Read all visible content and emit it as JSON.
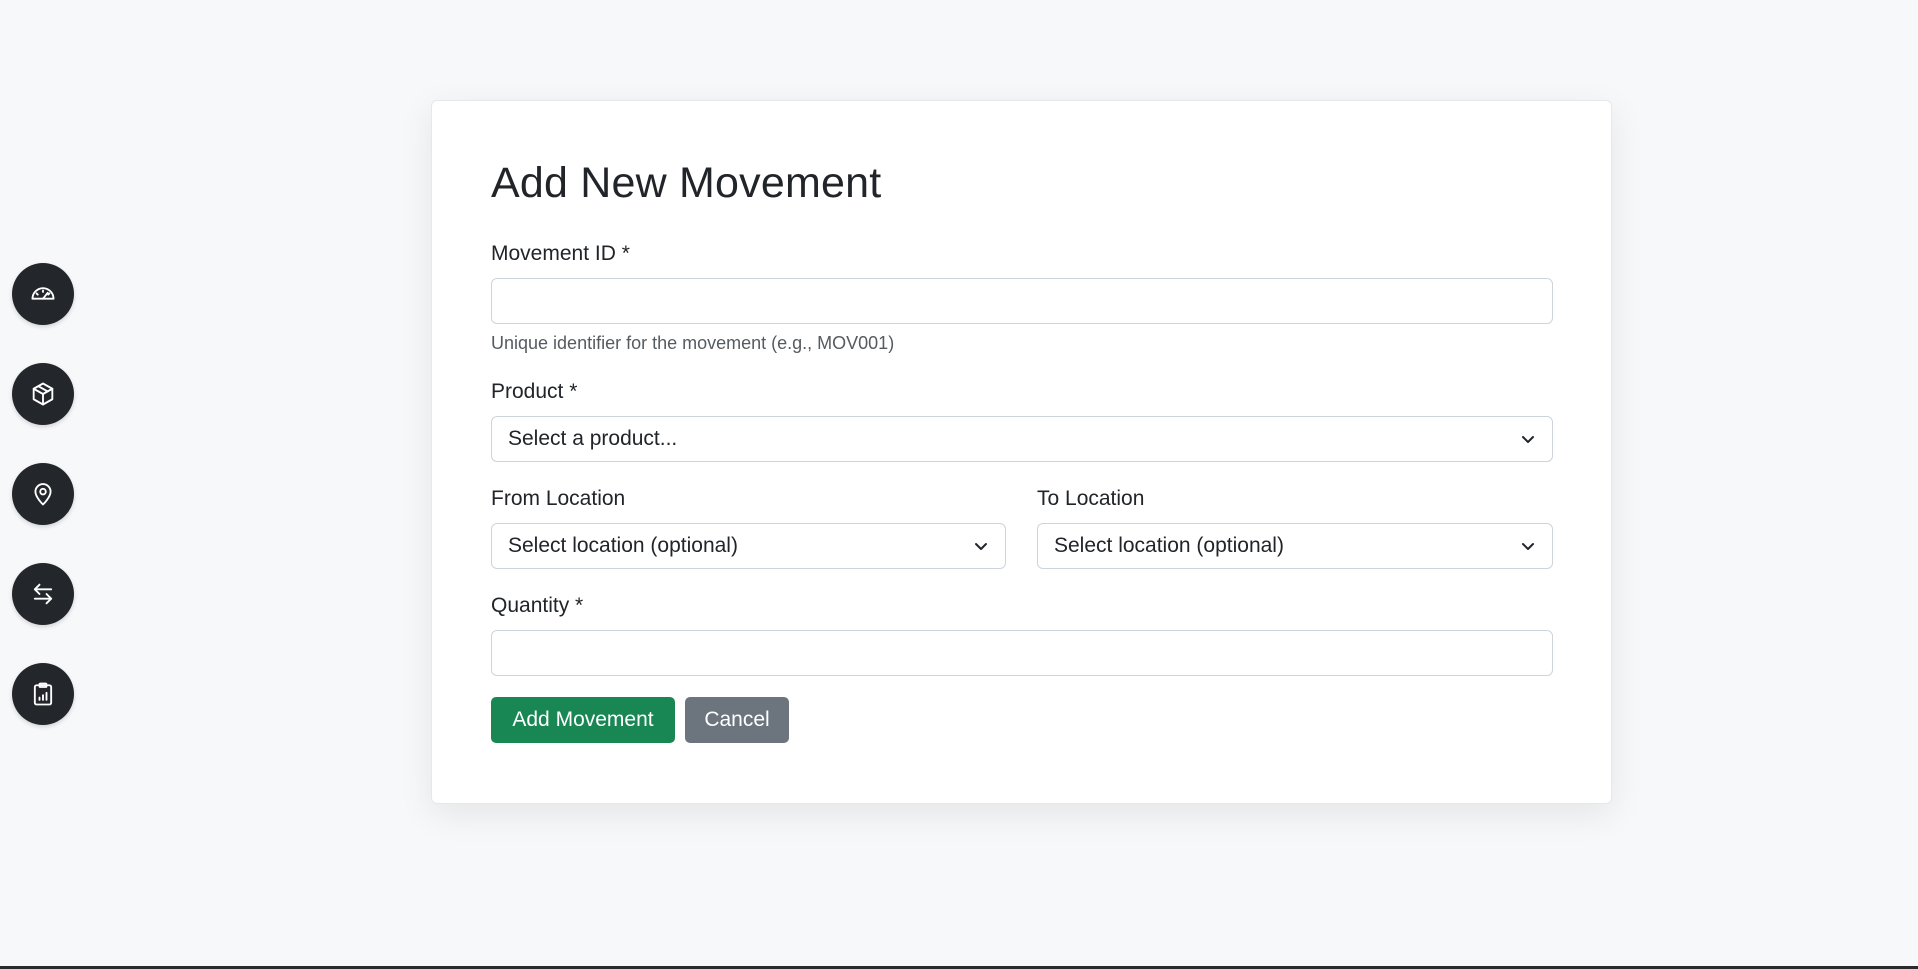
{
  "sidebar": {
    "items": [
      {
        "icon": "speedometer-icon",
        "name": "dashboard"
      },
      {
        "icon": "box-icon",
        "name": "products"
      },
      {
        "icon": "location-pin-icon",
        "name": "locations"
      },
      {
        "icon": "arrows-exchange-icon",
        "name": "movements"
      },
      {
        "icon": "clipboard-chart-icon",
        "name": "reports"
      }
    ]
  },
  "form": {
    "title": "Add New Movement",
    "movement_id": {
      "label": "Movement ID *",
      "value": "",
      "help": "Unique identifier for the movement (e.g., MOV001)"
    },
    "product": {
      "label": "Product *",
      "selected": "Select a product..."
    },
    "from_location": {
      "label": "From Location",
      "selected": "Select location (optional)"
    },
    "to_location": {
      "label": "To Location",
      "selected": "Select location (optional)"
    },
    "quantity": {
      "label": "Quantity *",
      "value": ""
    },
    "submit_label": "Add Movement",
    "cancel_label": "Cancel"
  },
  "colors": {
    "background": "#f7f8fa",
    "sidebar_button": "#23272b",
    "primary": "#198754",
    "secondary": "#6c757d"
  }
}
